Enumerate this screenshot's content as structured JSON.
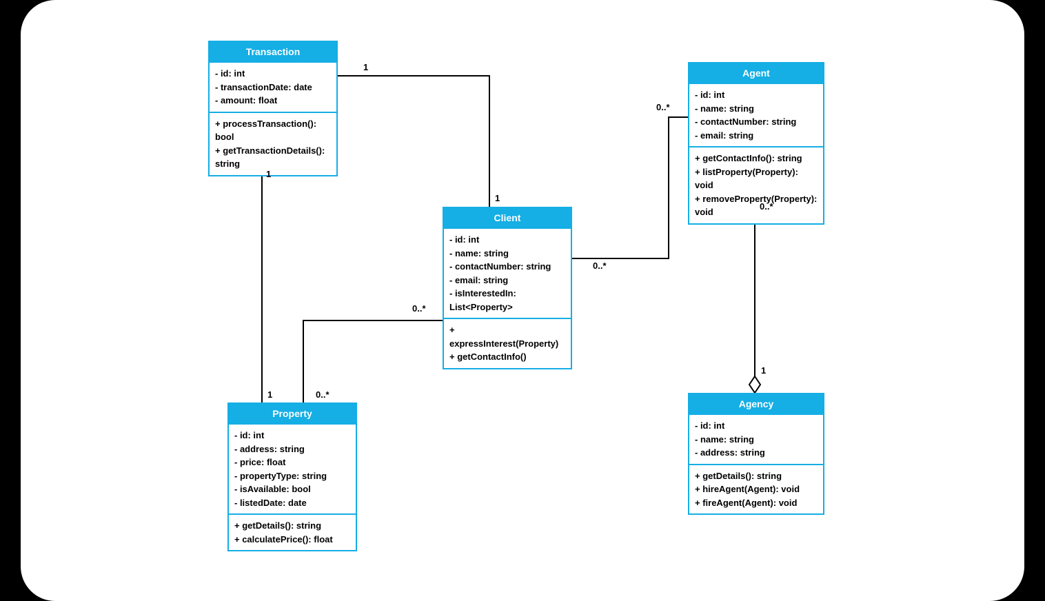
{
  "classes": {
    "transaction": {
      "title": "Transaction",
      "attrs": [
        "- id: int",
        "- transactionDate: date",
        "- amount: float"
      ],
      "methods": [
        "+ processTransaction(): bool",
        "+ getTransactionDetails(): string"
      ]
    },
    "client": {
      "title": "Client",
      "attrs": [
        "- id: int",
        "- name: string",
        "- contactNumber: string",
        "- email: string",
        "- isInterestedIn: List<Property>"
      ],
      "methods": [
        "+ expressInterest(Property)",
        "+ getContactInfo()"
      ]
    },
    "agent": {
      "title": "Agent",
      "attrs": [
        "- id: int",
        "- name: string",
        "- contactNumber: string",
        "- email: string"
      ],
      "methods": [
        "+ getContactInfo(): string",
        "+ listProperty(Property): void",
        "+ removeProperty(Property): void"
      ]
    },
    "property": {
      "title": "Property",
      "attrs": [
        "- id: int",
        "- address: string",
        "- price: float",
        "- propertyType: string",
        "- isAvailable: bool",
        "- listedDate: date"
      ],
      "methods": [
        "+ getDetails(): string",
        "+ calculatePrice(): float"
      ]
    },
    "agency": {
      "title": "Agency",
      "attrs": [
        "- id: int",
        "- name: string",
        "- address: string"
      ],
      "methods": [
        "+ getDetails(): string",
        "+ hireAgent(Agent): void",
        "+ fireAgent(Agent): void"
      ]
    }
  },
  "multiplicities": {
    "trans_top": "1",
    "trans_bottom": "1",
    "client_top": "1",
    "client_right": "0..*",
    "client_left": "0..*",
    "agent_left": "0..*",
    "agent_bottom": "0..*",
    "agency_top": "1",
    "property_top_left": "1",
    "property_top_right": "0..*"
  }
}
